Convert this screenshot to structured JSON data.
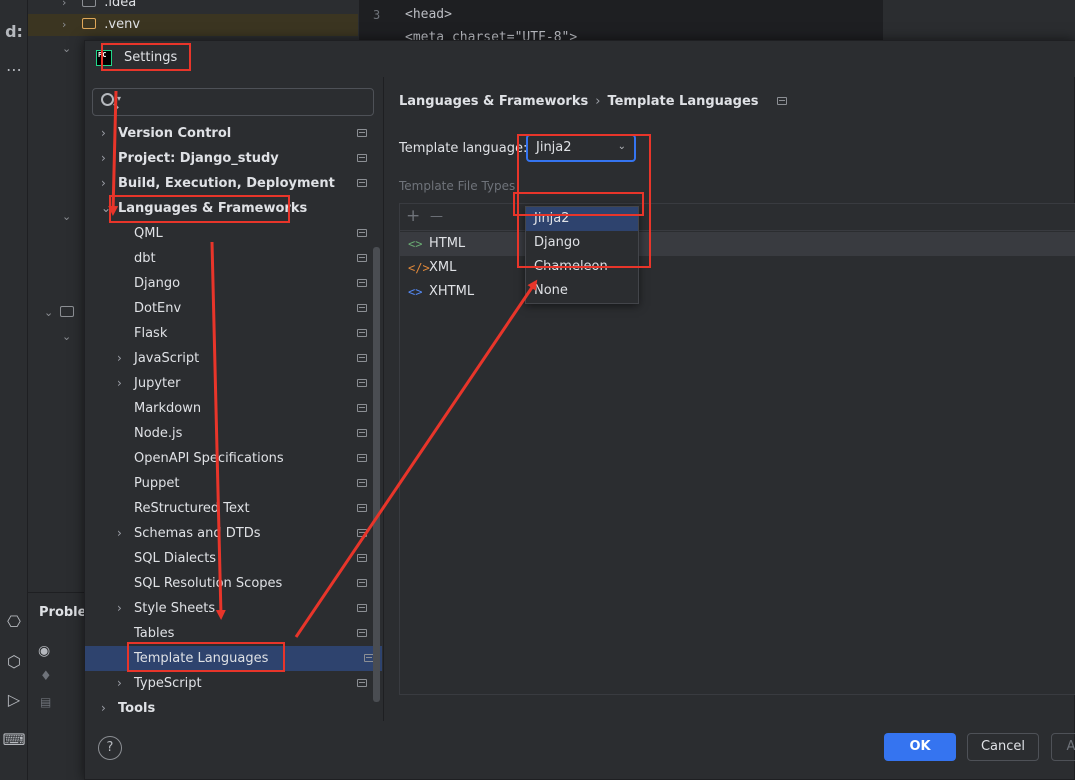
{
  "ide": {
    "project_tree": [
      {
        "chevron": "›",
        "name": ".idea"
      },
      {
        "chevron": "›",
        "name": ".venv"
      }
    ],
    "editor": {
      "line_numbers": [
        "3"
      ],
      "lines": [
        "<head>",
        "    <meta charset=\"UTF-8\">"
      ]
    },
    "problems_title": "Probler"
  },
  "dialog": {
    "title": "Settings",
    "search": {
      "placeholder": "",
      "value": ""
    },
    "tree": [
      {
        "label": "Version Control",
        "level": 0,
        "bold": true,
        "arrow": "›"
      },
      {
        "label": "Project: Django_study",
        "level": 0,
        "bold": true,
        "arrow": "›"
      },
      {
        "label": "Build, Execution, Deployment",
        "level": 0,
        "bold": true,
        "arrow": "›"
      },
      {
        "label": "Languages & Frameworks",
        "level": 0,
        "bold": true,
        "arrow": "⌄"
      },
      {
        "label": "QML",
        "level": 1
      },
      {
        "label": "dbt",
        "level": 1
      },
      {
        "label": "Django",
        "level": 1
      },
      {
        "label": "DotEnv",
        "level": 1
      },
      {
        "label": "Flask",
        "level": 1
      },
      {
        "label": "JavaScript",
        "level": 1,
        "arrow": "›"
      },
      {
        "label": "Jupyter",
        "level": 1,
        "arrow": "›"
      },
      {
        "label": "Markdown",
        "level": 1
      },
      {
        "label": "Node.js",
        "level": 1
      },
      {
        "label": "OpenAPI Specifications",
        "level": 1
      },
      {
        "label": "Puppet",
        "level": 1
      },
      {
        "label": "ReStructured Text",
        "level": 1
      },
      {
        "label": "Schemas and DTDs",
        "level": 1,
        "arrow": "›"
      },
      {
        "label": "SQL Dialects",
        "level": 1
      },
      {
        "label": "SQL Resolution Scopes",
        "level": 1
      },
      {
        "label": "Style Sheets",
        "level": 1,
        "arrow": "›"
      },
      {
        "label": "Tables",
        "level": 1
      },
      {
        "label": "Template Languages",
        "level": 1,
        "selected": true
      },
      {
        "label": "TypeScript",
        "level": 1,
        "arrow": "›"
      },
      {
        "label": "Tools",
        "level": 0,
        "bold": true,
        "arrow": "›"
      }
    ],
    "breadcrumb": {
      "parent": "Languages & Frameworks",
      "separator": "›",
      "current": "Template Languages"
    },
    "template_language": {
      "label": "Template language:",
      "selected": "Jinja2",
      "options": [
        "Jinja2",
        "Django",
        "Chameleon",
        "None"
      ]
    },
    "template_file_types": {
      "label": "Template File Types",
      "add_symbol": "+",
      "remove_symbol": "—",
      "rows": [
        {
          "icon": "<>",
          "icon_color": "#6aab73",
          "name": "HTML"
        },
        {
          "icon": "</>",
          "icon_color": "#e0883a",
          "name": "XML"
        },
        {
          "icon": "<>",
          "icon_color": "#548af7",
          "name": "XHTML"
        }
      ]
    },
    "help_symbol": "?",
    "buttons": {
      "ok": "OK",
      "cancel": "Cancel",
      "apply": "A"
    }
  },
  "colors": {
    "accent": "#3574f0",
    "selection": "#2e436e",
    "annotation": "#e8352a"
  }
}
